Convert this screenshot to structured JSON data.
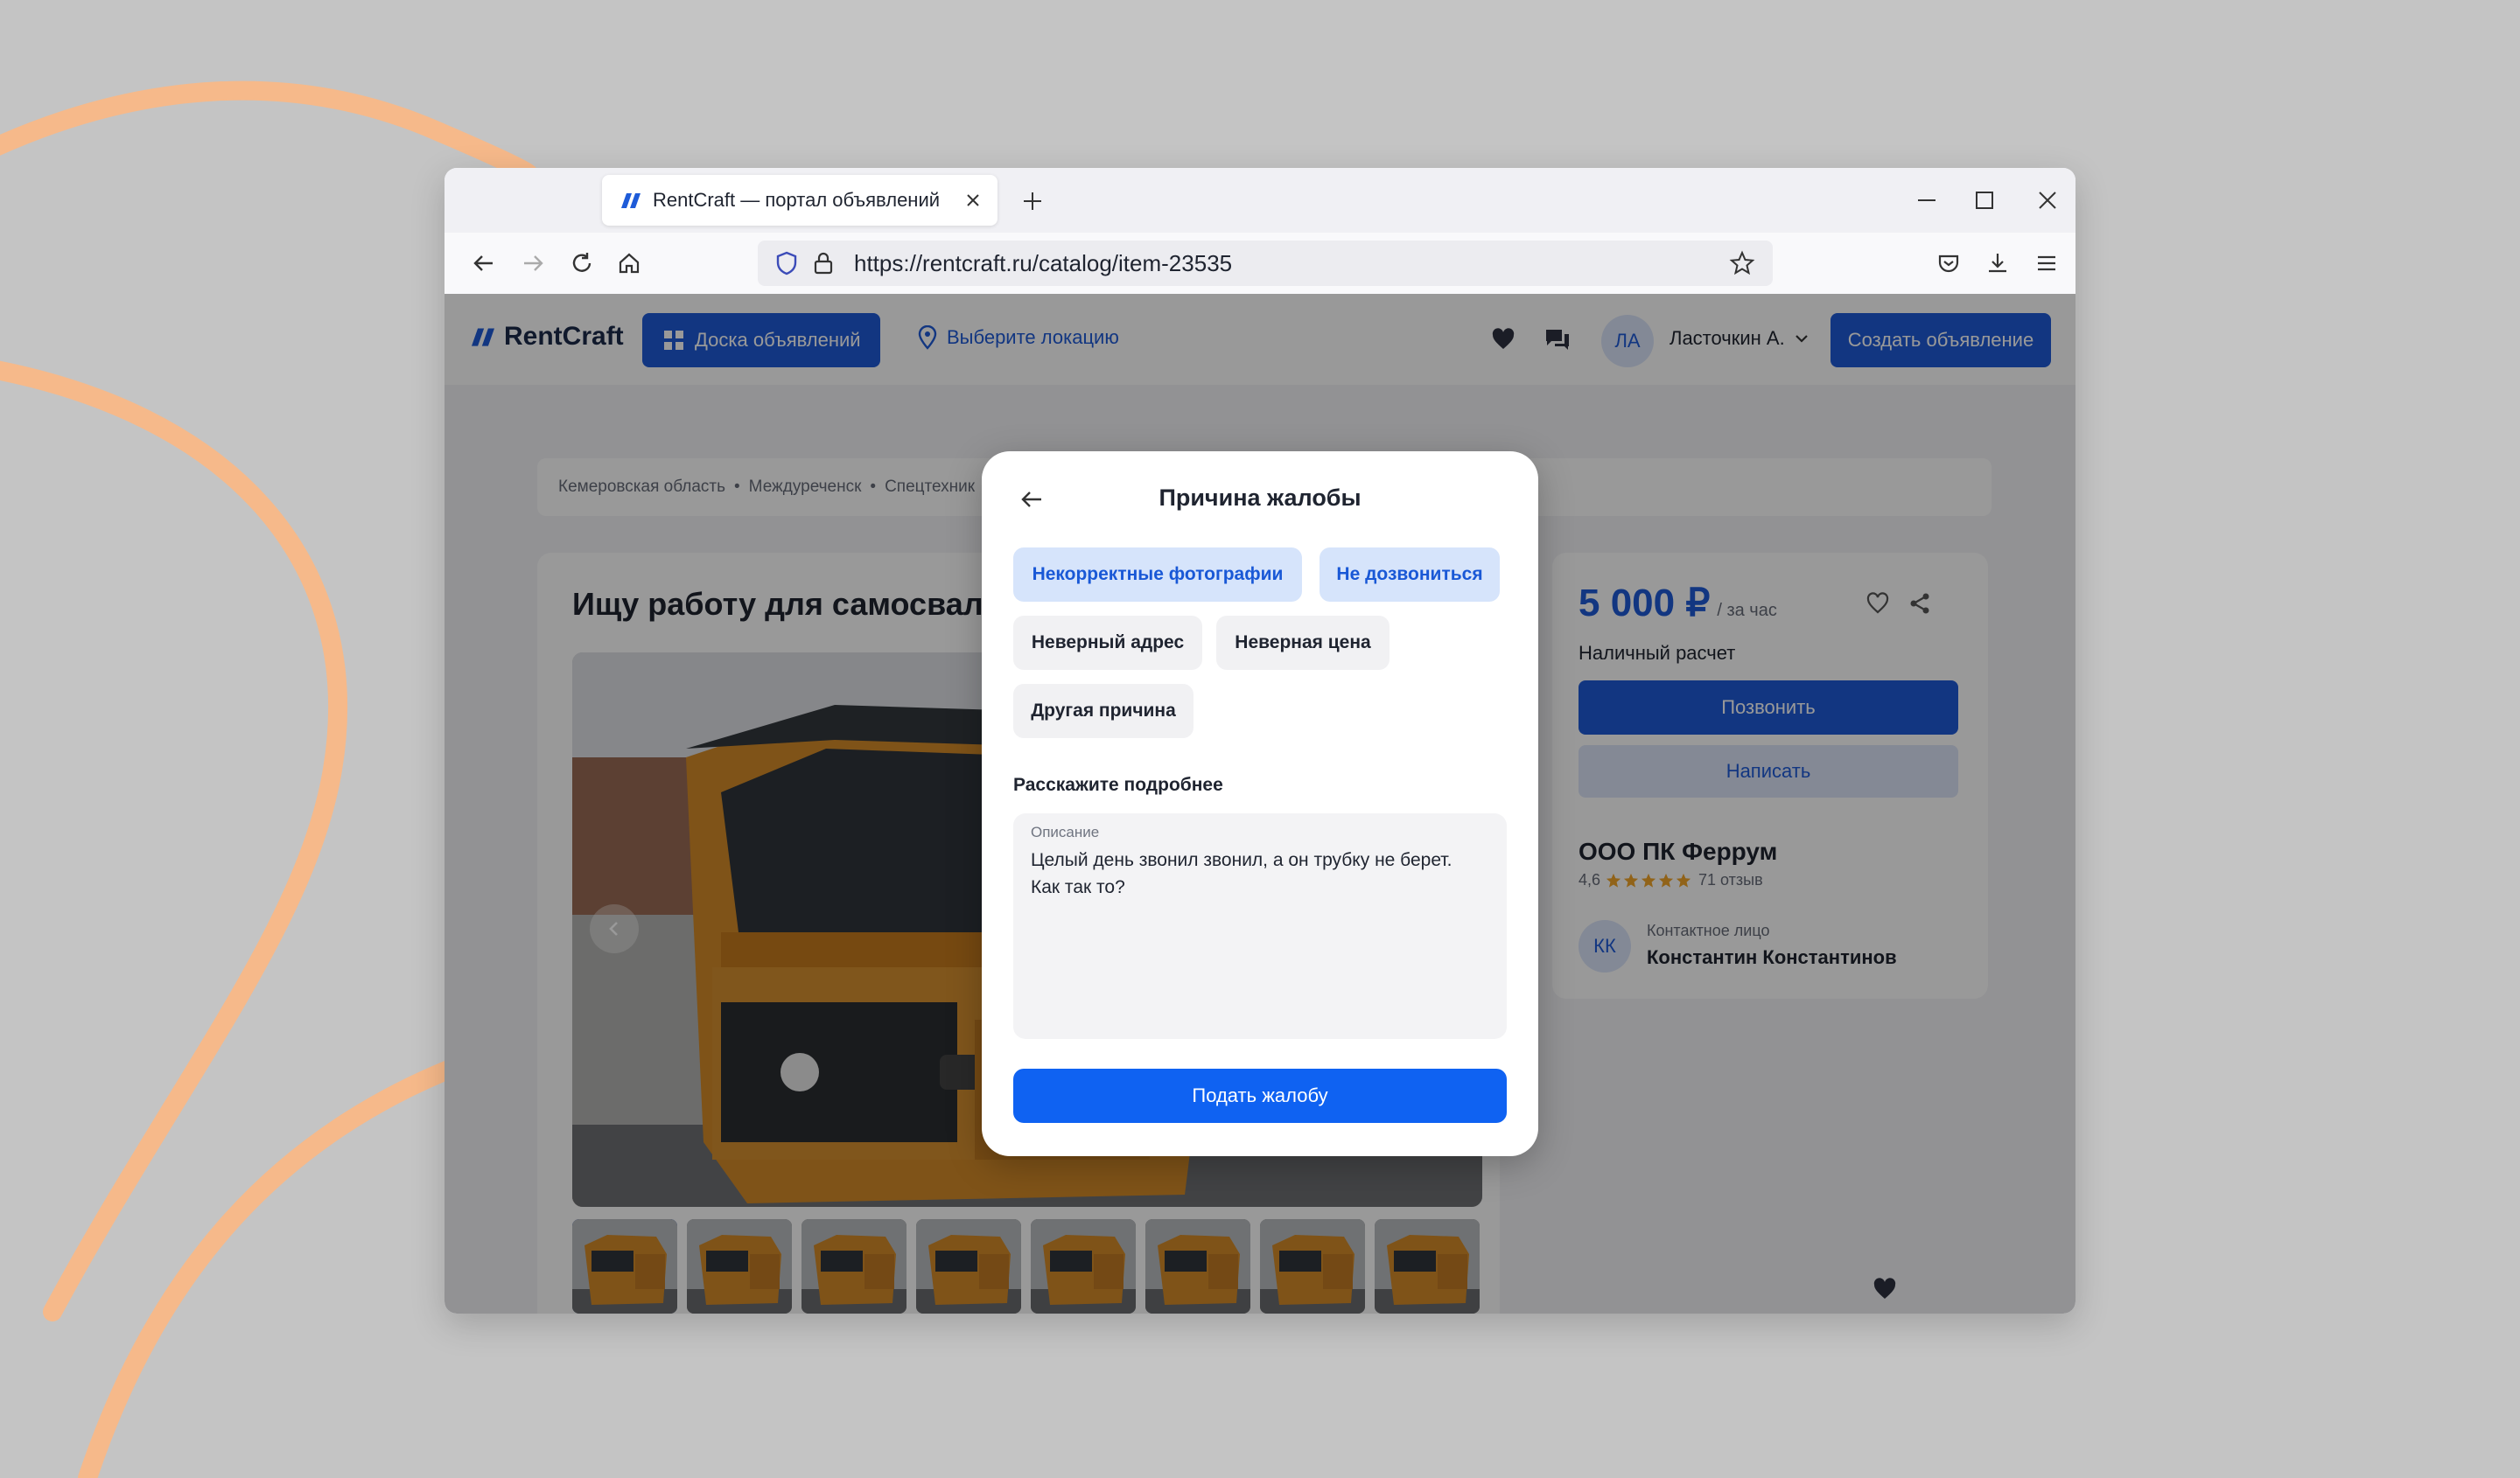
{
  "browser": {
    "tab_title": "RentCraft — портал объявлений",
    "url": "https://rentcraft.ru/catalog/item-23535"
  },
  "site": {
    "logo_text": "RentCraft",
    "board_button": "Доска объявлений",
    "location": "Выберите локацию",
    "user_initials": "ЛА",
    "user_name": "Ласточкин А.",
    "create_button": "Создать объявление",
    "brand_color": "#1e5bd8"
  },
  "breadcrumbs": [
    "Кемеровская область",
    "Междуреченск",
    "Спецтехник"
  ],
  "listing": {
    "title": "Ищу работу для самосвал",
    "price": "5 000 ₽",
    "price_unit": "/ за час",
    "payment": "Наличный расчет",
    "call_button": "Позвонить",
    "message_button": "Написать",
    "seller": "ООО ПК Феррум",
    "rating": "4,6",
    "rating_value": 4.6,
    "reviews": "71 отзыв",
    "contact_label": "Контактное лицо",
    "contact_name": "Константин Константинов",
    "contact_initials": "КК",
    "thumbnail_count": 8,
    "active_thumbnail": 1
  },
  "modal": {
    "title": "Причина жалобы",
    "reasons": [
      {
        "label": "Некорректные фотографии",
        "selected": true
      },
      {
        "label": "Не дозвониться",
        "selected": true
      },
      {
        "label": "Неверный адрес",
        "selected": false
      },
      {
        "label": "Неверная цена",
        "selected": false
      },
      {
        "label": "Другая причина",
        "selected": false
      }
    ],
    "details_title": "Расскажите подробнее",
    "description_label": "Описание",
    "description_value": "Целый день звонил звонил, а он трубку не берет.\nКак так то?",
    "submit_button": "Подать жалобу",
    "accent_color": "#0f62f2"
  }
}
